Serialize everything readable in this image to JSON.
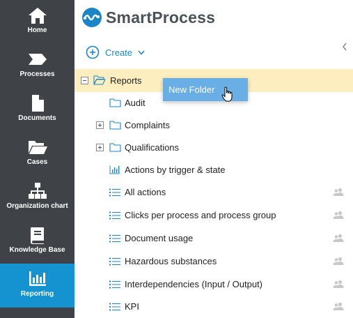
{
  "sidebar": {
    "items": [
      {
        "label": "Home",
        "icon": "home-icon",
        "active": false
      },
      {
        "label": "Processes",
        "icon": "process-arrow-icon",
        "active": false
      },
      {
        "label": "Documents",
        "icon": "document-icon",
        "active": false
      },
      {
        "label": "Cases",
        "icon": "folder-open-icon",
        "active": false
      },
      {
        "label": "Organization chart",
        "icon": "org-chart-icon",
        "active": false
      },
      {
        "label": "Knowledge Base",
        "icon": "book-icon",
        "active": false
      },
      {
        "label": "Reporting",
        "icon": "bar-chart-icon",
        "active": true
      }
    ],
    "colors": {
      "background": "#3f4347",
      "active": "#1593d1"
    }
  },
  "header": {
    "logo_text": "SmartProcess",
    "logo_color": "#1a86c8"
  },
  "toolbar": {
    "create_label": "Create"
  },
  "tree": {
    "root": {
      "label": "Reports",
      "expanded": true,
      "selected": true
    },
    "items": [
      {
        "label": "Audit",
        "type": "folder",
        "expandable": false,
        "shared": false
      },
      {
        "label": "Complaints",
        "type": "folder",
        "expandable": true,
        "shared": false
      },
      {
        "label": "Qualifications",
        "type": "folder",
        "expandable": true,
        "shared": false
      },
      {
        "label": "Actions by trigger & state",
        "type": "chart-report",
        "shared": false
      },
      {
        "label": "All actions",
        "type": "list-report",
        "shared": true
      },
      {
        "label": "Clicks per process and process group",
        "type": "list-report",
        "shared": true
      },
      {
        "label": "Document usage",
        "type": "list-report",
        "shared": true
      },
      {
        "label": "Hazardous substances",
        "type": "list-report",
        "shared": true
      },
      {
        "label": "Interdependencies (Input / Output)",
        "type": "list-report",
        "shared": true
      },
      {
        "label": "KPI",
        "type": "list-report",
        "shared": true
      }
    ]
  },
  "context_menu": {
    "new_folder_label": "New Folder"
  }
}
